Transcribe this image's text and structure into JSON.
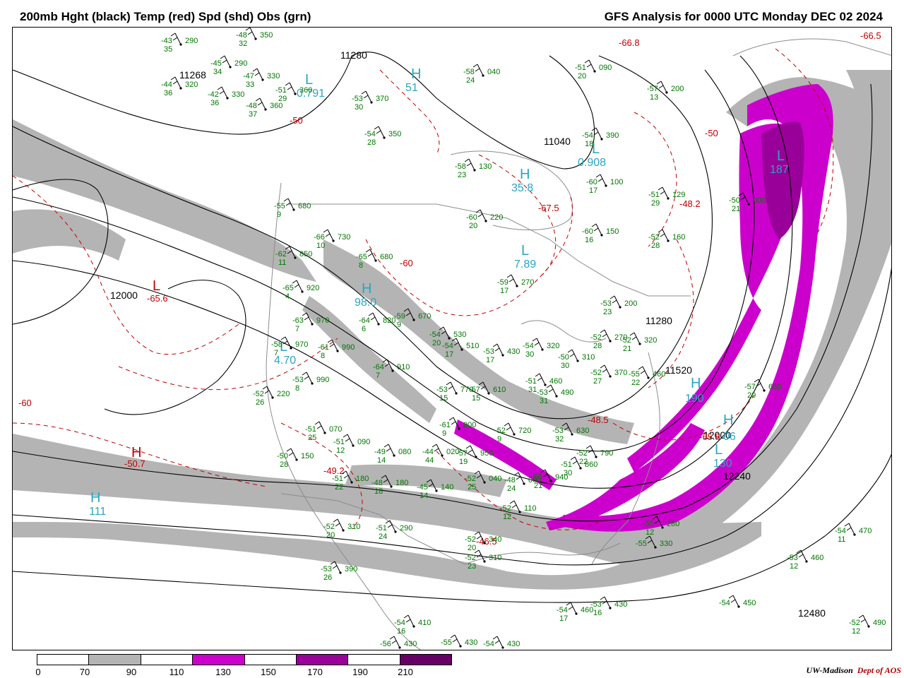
{
  "header": {
    "title_left": "200mb Hght (black) Temp (red) Spd (shd) Obs (grn)",
    "title_right": "GFS Analysis for 0000 UTC Monday  DEC 02 2024"
  },
  "colors": {
    "height_contour": "#000000",
    "temperature_contour": "#c00000",
    "obs_text": "#007700",
    "center_label": "#2aa6c0",
    "border_lines": "#8c8c8c"
  },
  "height_labels": [
    "11280",
    "11040",
    "11280",
    "11520",
    "12000",
    "12000",
    "12240",
    "12480",
    "11268"
  ],
  "temperature_labels": [
    "-65.6",
    "-66.5",
    "-66.8",
    "-67.5",
    "-48.2",
    "-50.7",
    "-49.2",
    "-48.5",
    "-65.8",
    "-46.5",
    "-50",
    "-50",
    "-60",
    "-60"
  ],
  "centers": [
    {
      "kind": "L",
      "value": "0.791",
      "color": "cyan"
    },
    {
      "kind": "H",
      "value": "51",
      "color": "cyan"
    },
    {
      "kind": "L",
      "value": "0.908",
      "color": "cyan"
    },
    {
      "kind": "H",
      "value": "35.8",
      "color": "cyan"
    },
    {
      "kind": "L",
      "value": "7.89",
      "color": "cyan"
    },
    {
      "kind": "H",
      "value": "98.0",
      "color": "cyan"
    },
    {
      "kind": "L",
      "value": "4.70",
      "color": "cyan"
    },
    {
      "kind": "H",
      "value": "111",
      "color": "cyan"
    },
    {
      "kind": "L",
      "value": "187",
      "color": "cyan"
    },
    {
      "kind": "H",
      "value": "190",
      "color": "cyan"
    },
    {
      "kind": "H",
      "value": "06",
      "color": "cyan"
    },
    {
      "kind": "L",
      "value": "130",
      "color": "cyan"
    },
    {
      "kind": "L",
      "value": "",
      "color": "red"
    },
    {
      "kind": "H",
      "value": "",
      "color": "red"
    }
  ],
  "observations": [
    {
      "temp": "-43",
      "dew": "35",
      "hgt": "290"
    },
    {
      "temp": "-48",
      "dew": "32",
      "hgt": "350"
    },
    {
      "temp": "-45",
      "dew": "34",
      "hgt": "290"
    },
    {
      "temp": "-47",
      "dew": "33",
      "hgt": "330"
    },
    {
      "temp": "-44",
      "dew": "36",
      "hgt": "320"
    },
    {
      "temp": "-42",
      "dew": "36",
      "hgt": "330"
    },
    {
      "temp": "-48",
      "dew": "37",
      "hgt": "360"
    },
    {
      "temp": "-51",
      "dew": "29",
      "hgt": "360"
    },
    {
      "temp": "-53",
      "dew": "30",
      "hgt": "370"
    },
    {
      "temp": "-54",
      "dew": "28",
      "hgt": "350"
    },
    {
      "temp": "-58",
      "dew": "23",
      "hgt": "130"
    },
    {
      "temp": "-58",
      "dew": "24",
      "hgt": "040"
    },
    {
      "temp": "-51",
      "dew": "20",
      "hgt": "090"
    },
    {
      "temp": "-57",
      "dew": "13",
      "hgt": "200"
    },
    {
      "temp": "-60",
      "dew": "20",
      "hgt": "220"
    },
    {
      "temp": "-60",
      "dew": "16",
      "hgt": "150"
    },
    {
      "temp": "-60",
      "dew": "17",
      "hgt": "100"
    },
    {
      "temp": "-51",
      "dew": "29",
      "hgt": "129"
    },
    {
      "temp": "-52",
      "dew": "28",
      "hgt": "160"
    },
    {
      "temp": "-59",
      "dew": "17",
      "hgt": "270"
    },
    {
      "temp": "-53",
      "dew": "23",
      "hgt": "200"
    },
    {
      "temp": "-55",
      "dew": "9",
      "hgt": "680"
    },
    {
      "temp": "-66",
      "dew": "10",
      "hgt": "730"
    },
    {
      "temp": "-65",
      "dew": "8",
      "hgt": "680"
    },
    {
      "temp": "-62",
      "dew": "11",
      "hgt": "850"
    },
    {
      "temp": "-65",
      "dew": "4",
      "hgt": "920"
    },
    {
      "temp": "-63",
      "dew": "7",
      "hgt": "970"
    },
    {
      "temp": "-64",
      "dew": "6",
      "hgt": "820"
    },
    {
      "temp": "-59",
      "dew": "9",
      "hgt": "670"
    },
    {
      "temp": "-58",
      "dew": "7",
      "hgt": "970"
    },
    {
      "temp": "-61",
      "dew": "8",
      "hgt": "990"
    },
    {
      "temp": "-53",
      "dew": "8",
      "hgt": "990"
    },
    {
      "temp": "-64",
      "dew": "7",
      "hgt": "910"
    },
    {
      "temp": "-54",
      "dew": "20",
      "hgt": "530"
    },
    {
      "temp": "-54",
      "dew": "17",
      "hgt": "510"
    },
    {
      "temp": "-53",
      "dew": "17",
      "hgt": "430"
    },
    {
      "temp": "-54",
      "dew": "30",
      "hgt": "320"
    },
    {
      "temp": "-50",
      "dew": "30",
      "hgt": "310"
    },
    {
      "temp": "-53",
      "dew": "15",
      "hgt": "770"
    },
    {
      "temp": "-57",
      "dew": "15",
      "hgt": "610"
    },
    {
      "temp": "-51",
      "dew": "31",
      "hgt": "460"
    },
    {
      "temp": "-53",
      "dew": "31",
      "hgt": "490"
    },
    {
      "temp": "-52",
      "dew": "26",
      "hgt": "220"
    },
    {
      "temp": "-51",
      "dew": "25",
      "hgt": "070"
    },
    {
      "temp": "-51",
      "dew": "12",
      "hgt": "090"
    },
    {
      "temp": "-50",
      "dew": "28",
      "hgt": "150"
    },
    {
      "temp": "-49",
      "dew": "14",
      "hgt": "080"
    },
    {
      "temp": "-44",
      "dew": "44",
      "hgt": "020"
    },
    {
      "temp": "-57",
      "dew": "19",
      "hgt": "950"
    },
    {
      "temp": "-52",
      "dew": "25",
      "hgt": "040"
    },
    {
      "temp": "-48",
      "dew": "24",
      "hgt": "000"
    },
    {
      "temp": "-51",
      "dew": "22",
      "hgt": "180"
    },
    {
      "temp": "-48",
      "dew": "18",
      "hgt": "180"
    },
    {
      "temp": "-45",
      "dew": "14",
      "hgt": "140"
    },
    {
      "temp": "-52",
      "dew": "20",
      "hgt": "310"
    },
    {
      "temp": "-51",
      "dew": "24",
      "hgt": "290"
    },
    {
      "temp": "-52",
      "dew": "20",
      "hgt": "340"
    },
    {
      "temp": "-52",
      "dew": "23",
      "hgt": "310"
    },
    {
      "temp": "-53",
      "dew": "26",
      "hgt": "390"
    },
    {
      "temp": "-54",
      "dew": "16",
      "hgt": "410"
    },
    {
      "temp": "-56",
      "dew": "",
      "hgt": "430"
    },
    {
      "temp": "-55",
      "dew": "",
      "hgt": "430"
    },
    {
      "temp": "-54",
      "dew": "",
      "hgt": "430"
    },
    {
      "temp": "-54",
      "dew": "17",
      "hgt": "460"
    },
    {
      "temp": "-53",
      "dew": "16",
      "hgt": "430"
    },
    {
      "temp": "-55",
      "dew": "12",
      "hgt": "280"
    },
    {
      "temp": "-55",
      "dew": "",
      "hgt": "330"
    },
    {
      "temp": "-54",
      "dew": "11",
      "hgt": "470"
    },
    {
      "temp": "-53",
      "dew": "12",
      "hgt": "460"
    },
    {
      "temp": "-54",
      "dew": "",
      "hgt": "450"
    },
    {
      "temp": "-52",
      "dew": "12",
      "hgt": "490"
    },
    {
      "temp": "-52",
      "dew": "22",
      "hgt": "790"
    },
    {
      "temp": "-51",
      "dew": "30",
      "hgt": "860"
    },
    {
      "temp": "-55",
      "dew": "21",
      "hgt": "940"
    },
    {
      "temp": "-52",
      "dew": "12",
      "hgt": "110"
    },
    {
      "temp": "-61",
      "dew": "9",
      "hgt": "900"
    },
    {
      "temp": "-52",
      "dew": "9",
      "hgt": "720"
    },
    {
      "temp": "-53",
      "dew": "32",
      "hgt": "630"
    },
    {
      "temp": "-52",
      "dew": "27",
      "hgt": "370"
    },
    {
      "temp": "-52",
      "dew": "28",
      "hgt": "270"
    },
    {
      "temp": "-52",
      "dew": "21",
      "hgt": "320"
    },
    {
      "temp": "-57",
      "dew": "20",
      "hgt": "650"
    },
    {
      "temp": "-50",
      "dew": "21",
      "hgt": "000"
    },
    {
      "temp": "-54",
      "dew": "18",
      "hgt": "390"
    },
    {
      "temp": "-55",
      "dew": "22",
      "hgt": "460"
    }
  ],
  "legend": {
    "ticks": [
      "0",
      "70",
      "90",
      "110",
      "130",
      "150",
      "170",
      "190",
      "210"
    ],
    "colors": [
      "#ffffff",
      "#b4b4b4",
      "#ffffff",
      "#cc00cc",
      "#ffffff",
      "#990099",
      "#ffffff",
      "#660066"
    ]
  },
  "credit": {
    "org": "UW-Madison",
    "dept": "Dept of AOS"
  }
}
